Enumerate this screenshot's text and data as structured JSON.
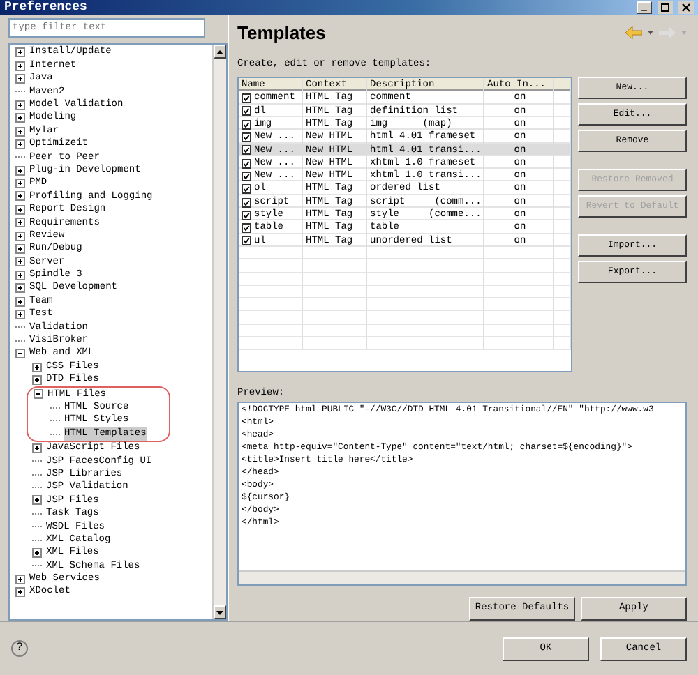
{
  "window": {
    "title": "Preferences"
  },
  "filter": {
    "placeholder": "type filter text"
  },
  "tree": [
    {
      "label": "Install/Update",
      "expanded": false,
      "selected": false
    },
    {
      "label": "Internet",
      "expanded": false,
      "selected": false
    },
    {
      "label": "Java",
      "expanded": false,
      "selected": false
    },
    {
      "label": "Maven2",
      "selected": false
    },
    {
      "label": "Model Validation",
      "expanded": false,
      "selected": false
    },
    {
      "label": "Modeling",
      "expanded": false,
      "selected": false
    },
    {
      "label": "Mylar",
      "expanded": false,
      "selected": false
    },
    {
      "label": "Optimizeit",
      "expanded": false,
      "selected": false
    },
    {
      "label": "Peer to Peer",
      "selected": false
    },
    {
      "label": "Plug-in Development",
      "expanded": false,
      "selected": false
    },
    {
      "label": "PMD",
      "expanded": false,
      "selected": false
    },
    {
      "label": "Profiling and Logging",
      "expanded": false,
      "selected": false
    },
    {
      "label": "Report Design",
      "expanded": false,
      "selected": false
    },
    {
      "label": "Requirements",
      "expanded": false,
      "selected": false
    },
    {
      "label": "Review",
      "expanded": false,
      "selected": false
    },
    {
      "label": "Run/Debug",
      "expanded": false,
      "selected": false
    },
    {
      "label": "Server",
      "expanded": false,
      "selected": false
    },
    {
      "label": "Spindle 3",
      "expanded": false,
      "selected": false
    },
    {
      "label": "SQL Development",
      "expanded": false,
      "selected": false
    },
    {
      "label": "Team",
      "expanded": false,
      "selected": false
    },
    {
      "label": "Test",
      "expanded": false,
      "selected": false
    },
    {
      "label": "Validation",
      "selected": false
    },
    {
      "label": "VisiBroker",
      "selected": false
    },
    {
      "label": "Web and XML",
      "expanded": true,
      "selected": false,
      "children": [
        {
          "label": "CSS Files",
          "expanded": false,
          "selected": false
        },
        {
          "label": "DTD Files",
          "expanded": false,
          "selected": false
        },
        {
          "label": "HTML Files",
          "expanded": true,
          "selected": false,
          "children": [
            {
              "label": "HTML Source",
              "selected": false
            },
            {
              "label": "HTML Styles",
              "selected": false
            },
            {
              "label": "HTML Templates",
              "selected": true
            }
          ]
        },
        {
          "label": "JavaScript Files",
          "expanded": false,
          "selected": false
        },
        {
          "label": "JSP FacesConfig UI",
          "selected": false
        },
        {
          "label": "JSP Libraries",
          "selected": false
        },
        {
          "label": "JSP Validation",
          "selected": false
        },
        {
          "label": "JSP Files",
          "expanded": false,
          "selected": false
        },
        {
          "label": "Task Tags",
          "selected": false
        },
        {
          "label": "WSDL Files",
          "selected": false
        },
        {
          "label": "XML Catalog",
          "selected": false
        },
        {
          "label": "XML Files",
          "expanded": false,
          "selected": false
        },
        {
          "label": "XML Schema Files",
          "selected": false
        }
      ]
    },
    {
      "label": "Web Services",
      "expanded": false,
      "selected": false
    },
    {
      "label": "XDoclet",
      "expanded": false,
      "selected": false
    }
  ],
  "page": {
    "title": "Templates",
    "description": "Create, edit or remove templates:"
  },
  "table": {
    "columns": [
      "Name",
      "Context",
      "Description",
      "Auto In..."
    ],
    "rows": [
      {
        "checked": true,
        "selected": false,
        "cells": [
          "comment",
          "HTML Tag",
          "comment",
          "on"
        ]
      },
      {
        "checked": true,
        "selected": false,
        "cells": [
          "dl",
          "HTML Tag",
          "definition list",
          "on"
        ]
      },
      {
        "checked": true,
        "selected": false,
        "cells": [
          "img",
          "HTML Tag",
          "img      (map)",
          "on"
        ]
      },
      {
        "checked": true,
        "selected": false,
        "cells": [
          "New ...",
          "New HTML",
          "html 4.01 frameset",
          "on"
        ]
      },
      {
        "checked": true,
        "selected": true,
        "cells": [
          "New ...",
          "New HTML",
          "html 4.01 transi...",
          "on"
        ]
      },
      {
        "checked": true,
        "selected": false,
        "cells": [
          "New ...",
          "New HTML",
          "xhtml 1.0 frameset",
          "on"
        ]
      },
      {
        "checked": true,
        "selected": false,
        "cells": [
          "New ...",
          "New HTML",
          "xhtml 1.0 transi...",
          "on"
        ]
      },
      {
        "checked": true,
        "selected": false,
        "cells": [
          "ol",
          "HTML Tag",
          "ordered list",
          "on"
        ]
      },
      {
        "checked": true,
        "selected": false,
        "cells": [
          "script",
          "HTML Tag",
          "script     (comm...",
          "on"
        ]
      },
      {
        "checked": true,
        "selected": false,
        "cells": [
          "style",
          "HTML Tag",
          "style     (comme...",
          "on"
        ]
      },
      {
        "checked": true,
        "selected": false,
        "cells": [
          "table",
          "HTML Tag",
          "table",
          "on"
        ]
      },
      {
        "checked": true,
        "selected": false,
        "cells": [
          "ul",
          "HTML Tag",
          "unordered list",
          "on"
        ]
      }
    ]
  },
  "side_buttons": [
    {
      "label": "New...",
      "disabled": false
    },
    {
      "label": "Edit...",
      "disabled": false
    },
    {
      "label": "Remove",
      "disabled": false
    },
    {
      "label": "Restore Removed",
      "disabled": true
    },
    {
      "label": "Revert to Default",
      "disabled": true
    },
    {
      "label": "Import...",
      "disabled": false
    },
    {
      "label": "Export...",
      "disabled": false
    }
  ],
  "preview": {
    "label": "Preview:",
    "lines": [
      "<!DOCTYPE html PUBLIC \"-//W3C//DTD HTML 4.01 Transitional//EN\" \"http://www.w3",
      "<html>",
      "<head>",
      "<meta http-equiv=\"Content-Type\" content=\"text/html; charset=${encoding}\">",
      "<title>Insert title here</title>",
      "</head>",
      "<body>",
      "${cursor}",
      "</body>",
      "</html>"
    ]
  },
  "page_buttons": [
    "Restore Defaults",
    "Apply"
  ],
  "dialog_buttons": [
    "OK",
    "Cancel"
  ],
  "help": {
    "icon_text": "?"
  }
}
